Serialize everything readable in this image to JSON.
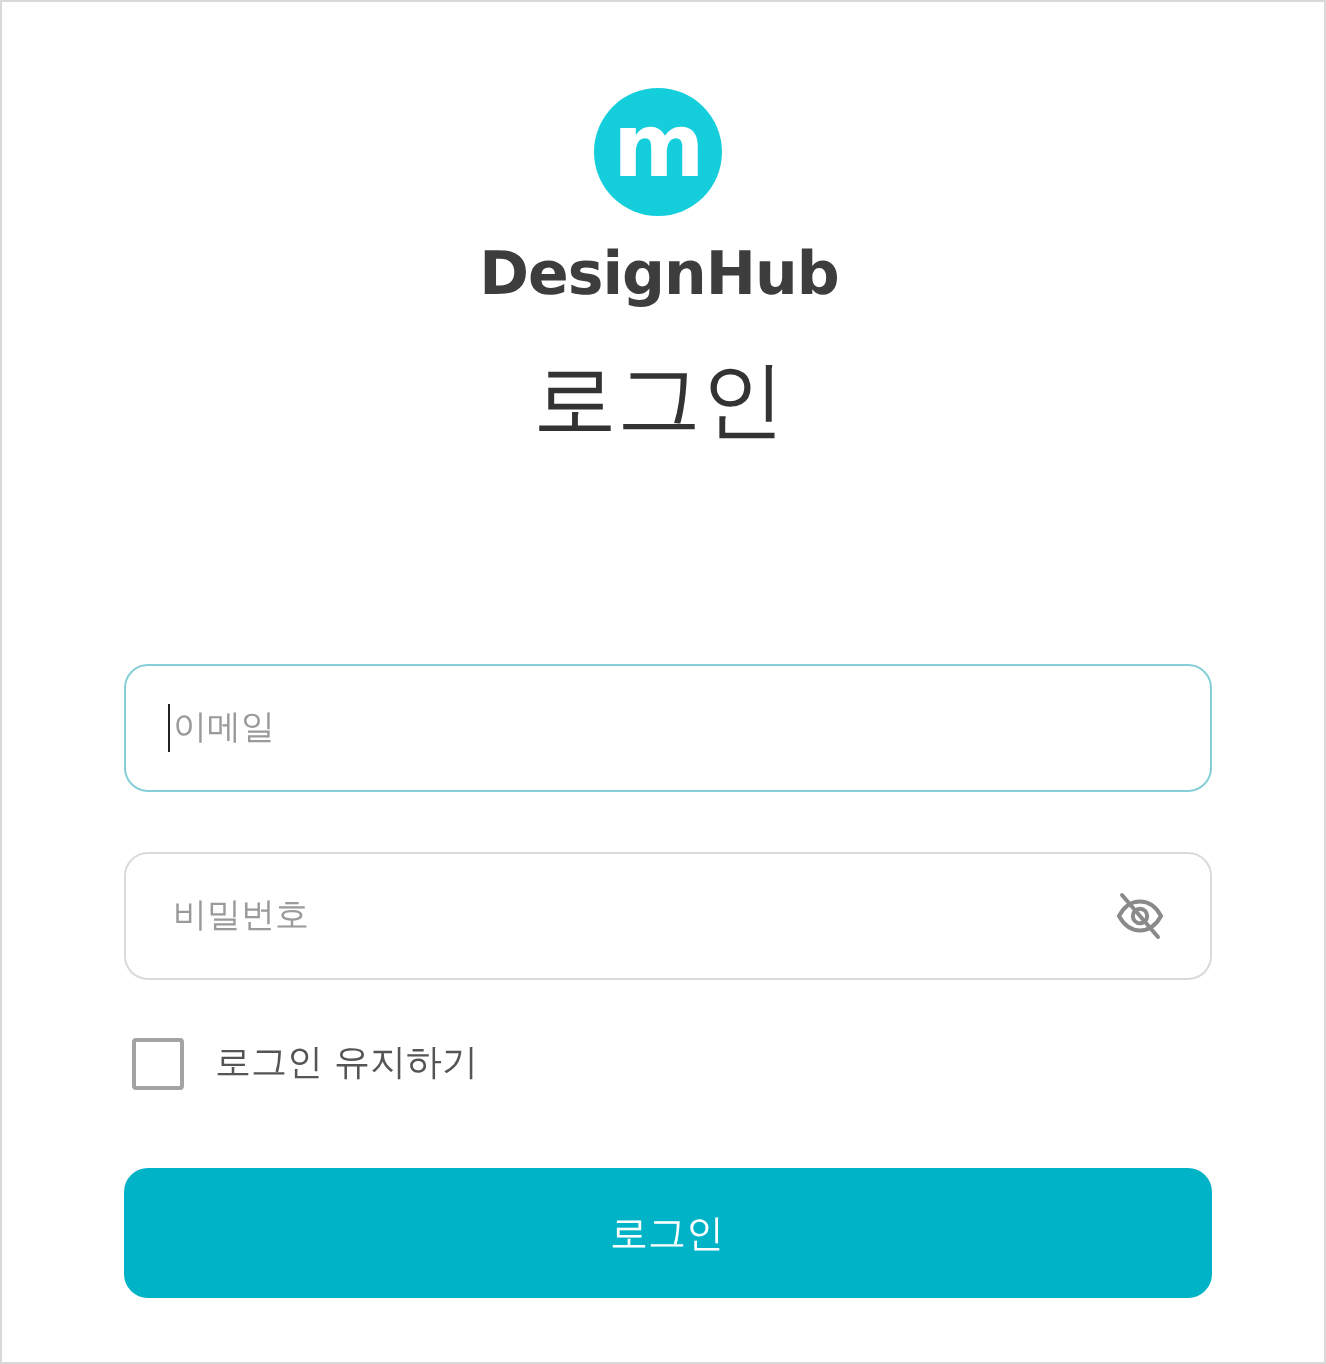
{
  "logo": {
    "letter": "m",
    "brand": "DesignHub"
  },
  "title": "로그인",
  "fields": [
    {
      "kind": "email",
      "placeholder": "이메일",
      "focused": true
    },
    {
      "kind": "password",
      "placeholder": "비밀번호",
      "focused": false,
      "value_visible": false
    }
  ],
  "remember_me": {
    "label": "로그인 유지하기",
    "checked": false
  },
  "submit_button": {
    "label": "로그인"
  }
}
